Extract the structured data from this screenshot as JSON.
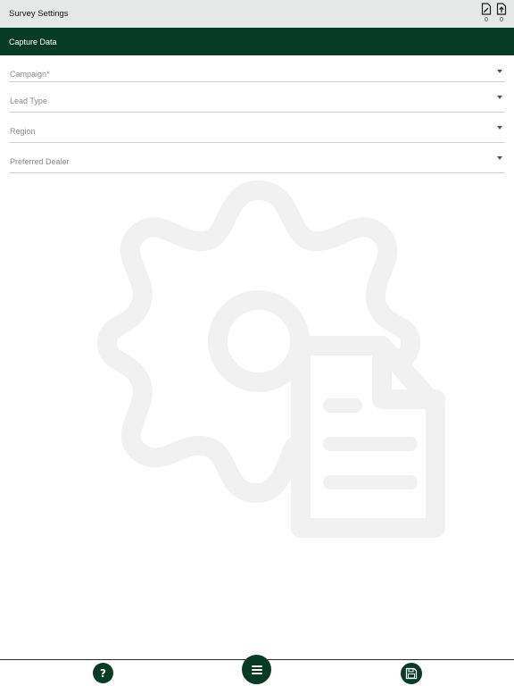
{
  "header": {
    "title": "Survey Settings",
    "icons": [
      {
        "name": "edit-document-icon",
        "count": "0"
      },
      {
        "name": "upload-document-icon",
        "count": "0"
      }
    ]
  },
  "section": {
    "title": "Capture Data"
  },
  "form": {
    "fields": [
      {
        "label": "Campaign*",
        "icon": "dropdown-caret-icon"
      },
      {
        "label": "Lead Type",
        "icon": "dropdown-caret-icon"
      },
      {
        "label": "Region",
        "icon": "dropdown-caret-icon"
      },
      {
        "label": "Preferred Dealer",
        "icon": "dropdown-caret-icon"
      }
    ]
  },
  "illustration": {
    "icon": "gear-document-icon",
    "color": "#f1f1f1"
  },
  "footer": {
    "buttons": [
      {
        "name": "help-button",
        "glyph": "?"
      },
      {
        "name": "menu-button",
        "icon": "hamburger-menu-icon"
      },
      {
        "name": "save-button",
        "icon": "floppy-disk-icon"
      }
    ]
  },
  "colors": {
    "brand": "#063b26",
    "topbar": "#e4e8e7",
    "divider": "#d3d3d3"
  }
}
